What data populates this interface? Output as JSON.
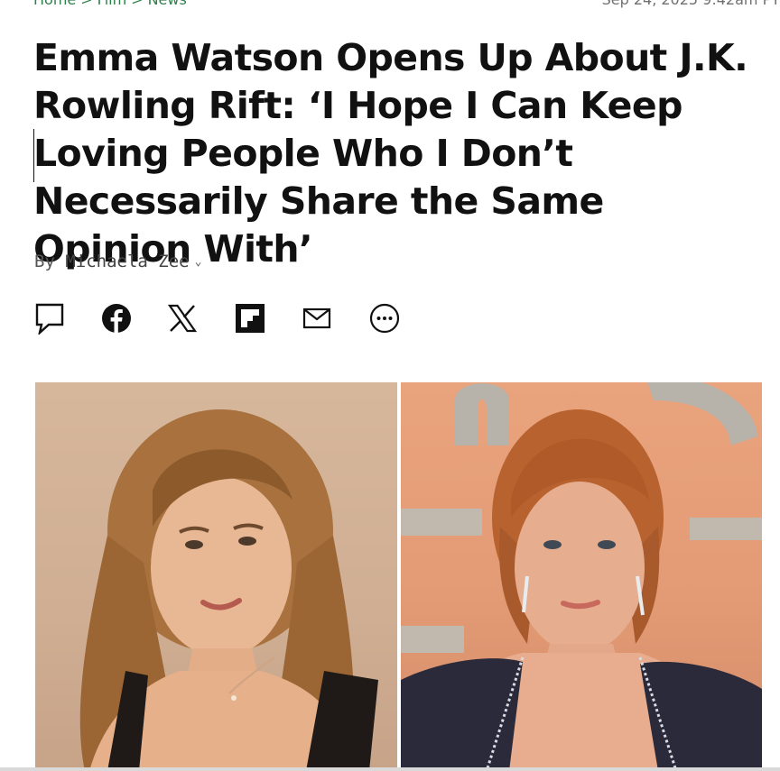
{
  "breadcrumb": {
    "items": [
      "Home",
      "Film",
      "News"
    ],
    "separator": ">"
  },
  "date": "Sep 24, 2025 9:42am PT",
  "headline": "Emma Watson Opens Up About J.K. Rowling Rift: ‘I Hope I Can Keep Loving People Who I Don’t Necessarily Share the Same Opinion With’",
  "byline": {
    "prefix": "By",
    "author": "Michaela Zee",
    "chevron": "⌄"
  },
  "share": [
    {
      "icon": "comment-icon"
    },
    {
      "icon": "facebook-icon"
    },
    {
      "icon": "x-icon"
    },
    {
      "icon": "flipboard-icon"
    },
    {
      "icon": "email-icon"
    },
    {
      "icon": "more-icon"
    }
  ],
  "colors": {
    "breadcrumb": "#2f7f4b",
    "date": "#707070",
    "headline": "#111111",
    "byline": "#555555"
  }
}
